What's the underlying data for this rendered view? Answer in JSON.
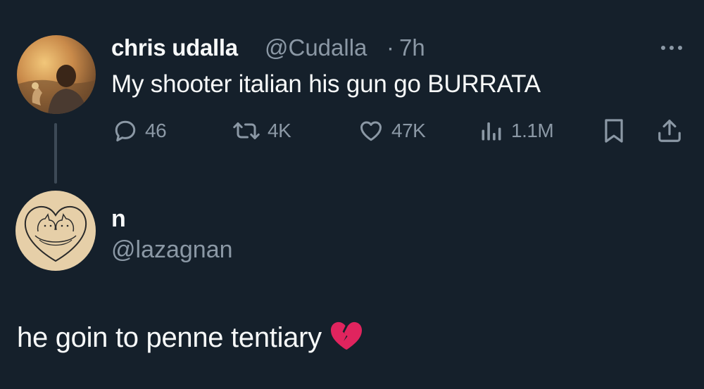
{
  "original_tweet": {
    "author_name": "chris udalla",
    "handle": "@Cudalla",
    "separator": "·",
    "time": "7h",
    "text": "My shooter italian his gun go BURRATA",
    "actions": {
      "replies": "46",
      "reposts": "4K",
      "likes": "47K",
      "views": "1.1M"
    },
    "icons": {
      "reply": "reply-icon",
      "repost": "repost-icon",
      "like": "heart-icon",
      "views": "views-icon",
      "bookmark": "bookmark-icon",
      "share": "share-icon",
      "more": "more-icon"
    }
  },
  "reply_tweet": {
    "author_name": "n",
    "handle": "@lazagnan",
    "text": "he goin to penne tentiary",
    "emoji": "broken-heart-emoji"
  },
  "colors": {
    "background": "#15202b",
    "primary_text": "#f7f9f9",
    "secondary_text": "#8b98a5",
    "thread_line": "#3d4a57",
    "broken_heart": "#e0245e"
  }
}
